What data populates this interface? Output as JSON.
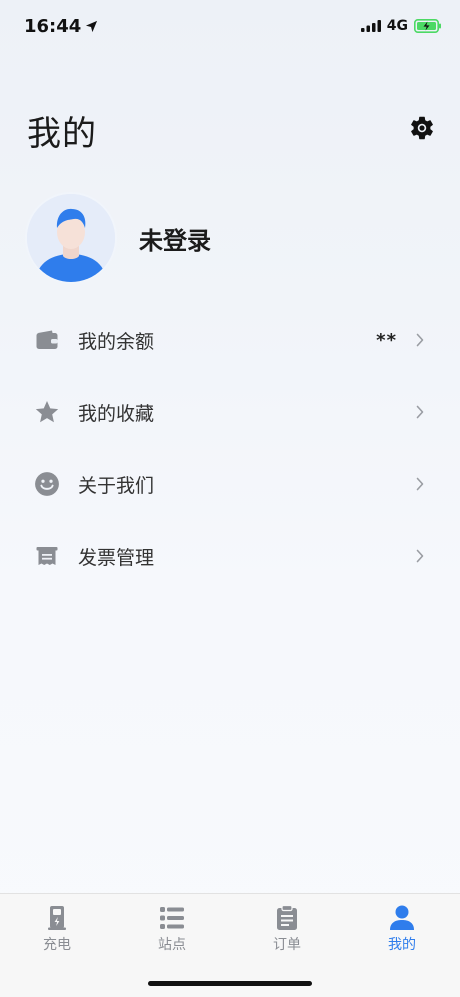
{
  "status": {
    "time": "16:44",
    "network": "4G"
  },
  "header": {
    "title": "我的"
  },
  "profile": {
    "login_text": "未登录"
  },
  "menu": [
    {
      "label": "我的余额",
      "value": "**",
      "icon": "wallet-icon"
    },
    {
      "label": "我的收藏",
      "value": "",
      "icon": "star-icon"
    },
    {
      "label": "关于我们",
      "value": "",
      "icon": "smiley-icon"
    },
    {
      "label": "发票管理",
      "value": "",
      "icon": "invoice-icon"
    }
  ],
  "tabs": [
    {
      "label": "充电",
      "icon": "charger-icon",
      "active": false
    },
    {
      "label": "站点",
      "icon": "list-icon",
      "active": false
    },
    {
      "label": "订单",
      "icon": "clipboard-icon",
      "active": false
    },
    {
      "label": "我的",
      "icon": "person-icon",
      "active": true
    }
  ],
  "colors": {
    "accent": "#2f7dec",
    "icon_gray": "#8a8d93",
    "battery_green": "#4cd964"
  }
}
